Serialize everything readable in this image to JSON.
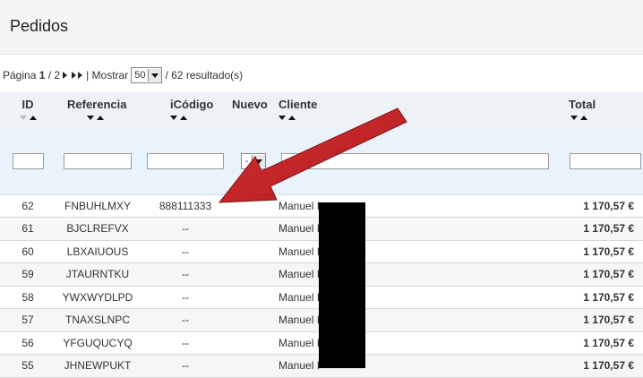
{
  "header": {
    "title": "Pedidos"
  },
  "pager": {
    "page_label": "Página",
    "current_page": "1",
    "page_sep": "/ 2",
    "show_label": "| Mostrar",
    "per_page": "50",
    "results": "/ 62 resultado(s)"
  },
  "columns": {
    "id": "ID",
    "reference": "Referencia",
    "code": "iCódigo",
    "new": "Nuevo",
    "client": "Cliente",
    "total": "Total"
  },
  "filters": {
    "new_value": "-"
  },
  "rows": [
    {
      "id": "62",
      "reference": "FNBUHLMXY",
      "code": "888111333",
      "client": "Manuel I",
      "total": "1 170,57 €"
    },
    {
      "id": "61",
      "reference": "BJCLREFVX",
      "code": "--",
      "client": "Manuel I",
      "total": "1 170,57 €"
    },
    {
      "id": "60",
      "reference": "LBXAIUOUS",
      "code": "--",
      "client": "Manuel I",
      "total": "1 170,57 €"
    },
    {
      "id": "59",
      "reference": "JTAURNTKU",
      "code": "--",
      "client": "Manuel I",
      "total": "1 170,57 €"
    },
    {
      "id": "58",
      "reference": "YWXWYDLPD",
      "code": "--",
      "client": "Manuel I",
      "total": "1 170,57 €"
    },
    {
      "id": "57",
      "reference": "TNAXSLNPC",
      "code": "--",
      "client": "Manuel I",
      "total": "1 170,57 €"
    },
    {
      "id": "56",
      "reference": "YFGUQUCYQ",
      "code": "--",
      "client": "Manuel I",
      "total": "1 170,57 €"
    },
    {
      "id": "55",
      "reference": "JHNEWPUKT",
      "code": "--",
      "client": "Manuel I",
      "total": "1 170,57 €"
    }
  ],
  "colors": {
    "annotation_arrow": "#c8161d",
    "filter_row": "#eaf3fb",
    "header_row": "#eef2f6"
  }
}
